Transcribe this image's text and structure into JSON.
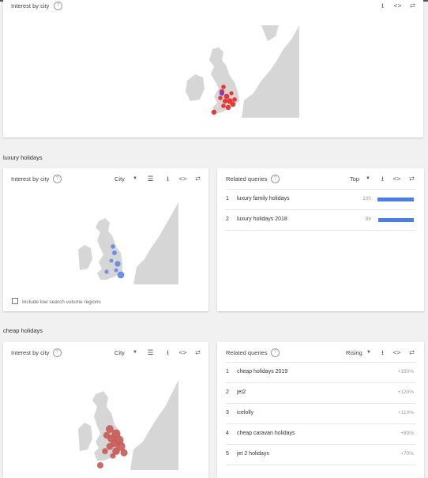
{
  "colors": {
    "accent": "#4d7ee8",
    "map_red": "#e53935",
    "map_blue": "#6e8fe8",
    "map_salmon": "#c85a55"
  },
  "icons": {
    "help": "help-circle-icon",
    "download": "download-icon",
    "embed": "embed-icon",
    "share": "share-icon",
    "list": "list-view-icon",
    "dropdown": "dropdown-arrow-icon"
  },
  "top_card": {
    "title": "Interest by city",
    "help_glyph": "?"
  },
  "section1": {
    "label": "luxury holidays",
    "interest": {
      "title": "Interest by city",
      "help_glyph": "?",
      "selector": "City",
      "checkbox_label": "Include low search volume regions"
    },
    "related": {
      "title": "Related queries",
      "help_glyph": "?",
      "selector": "Top",
      "rows": [
        {
          "num": "1",
          "query": "luxury family holidays",
          "value": "100",
          "bar_pct": 100
        },
        {
          "num": "2",
          "query": "luxury holidays 2018",
          "value": "98",
          "bar_pct": 98
        }
      ]
    }
  },
  "section2": {
    "label": "cheap holidays",
    "interest": {
      "title": "Interest by city",
      "help_glyph": "?",
      "selector": "City"
    },
    "related": {
      "title": "Related queries",
      "help_glyph": "?",
      "selector": "Rising",
      "rows": [
        {
          "num": "1",
          "query": "cheap holidays 2019",
          "value": "+150%"
        },
        {
          "num": "2",
          "query": "jet2",
          "value": "+120%"
        },
        {
          "num": "3",
          "query": "icelolly",
          "value": "+110%"
        },
        {
          "num": "4",
          "query": "cheap caravan holidays",
          "value": "+80%"
        },
        {
          "num": "5",
          "query": "jet 2 holidays",
          "value": "+70%"
        }
      ]
    }
  }
}
